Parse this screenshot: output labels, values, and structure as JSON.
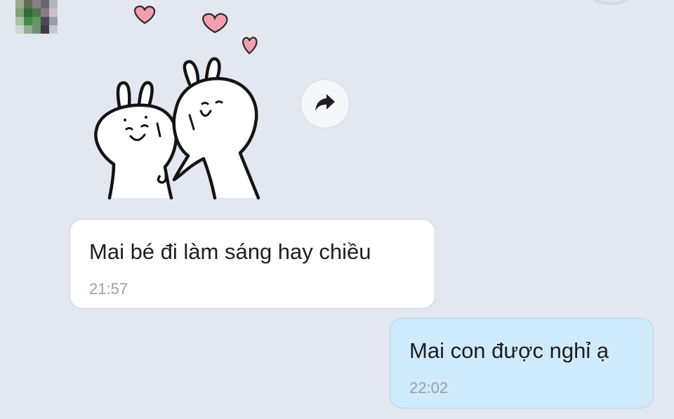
{
  "conversation": {
    "sender": {
      "avatar_icon": "pixelated-avatar-icon"
    },
    "messages": [
      {
        "type": "sticker",
        "direction": "incoming",
        "sticker_icon": "two-rabbits-hugging-hearts-sticker-icon",
        "share_icon": "share-arrow-icon"
      },
      {
        "type": "text",
        "direction": "incoming",
        "text": "Mai bé đi làm sáng hay chiều",
        "time": "21:57"
      },
      {
        "type": "text",
        "direction": "outgoing",
        "text": "Mai con được nghỉ ạ",
        "time": "22:02"
      }
    ]
  },
  "colors": {
    "background": "#e3e7f0",
    "incoming_bubble": "#ffffff",
    "outgoing_bubble": "#cfeafb",
    "heart": "#f2a0b0",
    "timestamp": "#9a9ea8"
  }
}
